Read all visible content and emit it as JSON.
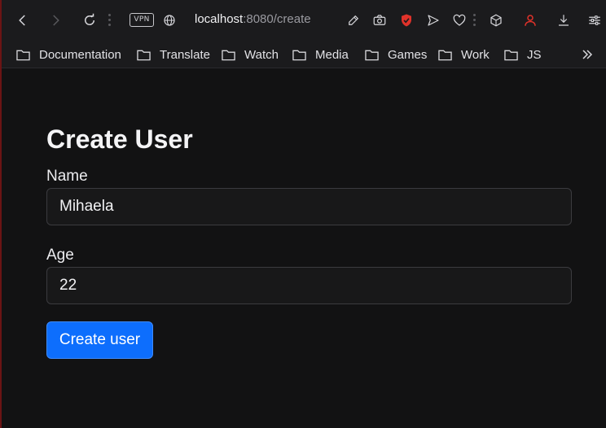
{
  "toolbar": {
    "vpn_label": "VPN",
    "url_host": "localhost",
    "url_rest": ":8080/create",
    "icons": [
      "back-icon",
      "forward-icon",
      "reload-icon",
      "vpn-badge",
      "site-info-icon",
      "edit-icon",
      "camera-icon",
      "shield-icon",
      "send-icon",
      "heart-icon",
      "cube-icon",
      "profile-icon",
      "download-icon",
      "settings-icon"
    ],
    "colors": {
      "shield": "#e0322a",
      "profile": "#e0322a"
    }
  },
  "bookmarks": {
    "items": [
      {
        "label": "Documentation"
      },
      {
        "label": "Translate"
      },
      {
        "label": "Watch"
      },
      {
        "label": "Media"
      },
      {
        "label": "Games"
      },
      {
        "label": "Work"
      },
      {
        "label": "JS"
      }
    ],
    "more_icon": "double-chevron-right-icon"
  },
  "form": {
    "title": "Create User",
    "name_label": "Name",
    "name_value": "Mihaela",
    "age_label": "Age",
    "age_value": "22",
    "submit_label": "Create user",
    "accent": "#0d6efd"
  }
}
